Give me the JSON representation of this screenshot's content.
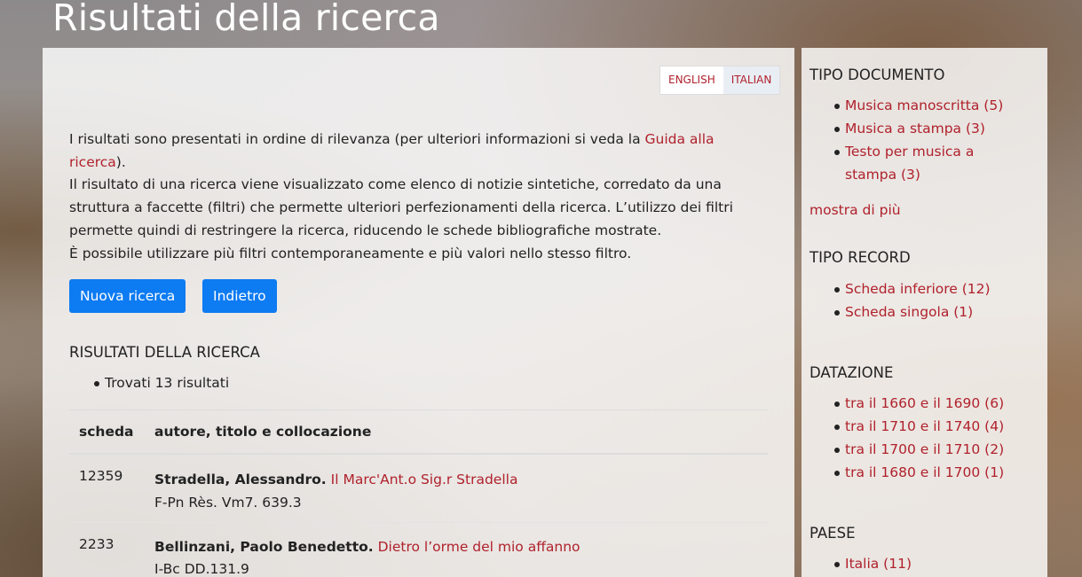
{
  "page_title": "Risultati della ricerca",
  "lang": {
    "english": "ENGLISH",
    "italian": "ITALIAN"
  },
  "intro": {
    "p1_before": "I risultati sono presentati in ordine di rilevanza (per ulteriori informazioni si veda la ",
    "p1_link": "Guida alla ricerca",
    "p1_after": ").",
    "p2": "Il risultato di una ricerca viene visualizzato come elenco di notizie sintetiche, corredato da una struttura a faccette (filtri) che permette ulteriori perfezionamenti della ricerca. L’utilizzo dei filtri permette quindi di restringere la ricerca, riducendo le schede bibliografiche mostrate.",
    "p3": "È possibile utilizzare più filtri contemporaneamente e più valori nello stesso filtro."
  },
  "buttons": {
    "new_search": "Nuova ricerca",
    "back": "Indietro"
  },
  "results": {
    "heading": "RISULTATI DELLA RICERCA",
    "count": "Trovati 13 risultati",
    "columns": [
      "scheda",
      "autore, titolo e collocazione"
    ],
    "rows": [
      {
        "id": "12359",
        "author": "Stradella, Alessandro.",
        "title": "Il Marc'Ant.o Sig.r Stradella",
        "shelfmark": "F-Pn Rès. Vm7. 639.3"
      },
      {
        "id": "2233",
        "author": "Bellinzani, Paolo Benedetto.",
        "title": "Dietro l’orme del mio affanno",
        "shelfmark": "I-Bc DD.131.9"
      }
    ]
  },
  "facets": {
    "tipo_documento": {
      "heading": "TIPO DOCUMENTO",
      "items": [
        "Musica manoscritta (5)",
        "Musica a stampa (3)",
        "Testo per musica a stampa (3)"
      ],
      "more": "mostra di più"
    },
    "tipo_record": {
      "heading": "TIPO RECORD",
      "items": [
        "Scheda inferiore (12)",
        "Scheda singola (1)"
      ]
    },
    "datazione": {
      "heading": "DATAZIONE",
      "items": [
        "tra il 1660 e il 1690 (6)",
        "tra il 1710 e il 1740 (4)",
        "tra il 1700 e il 1710 (2)",
        "tra il 1680 e il 1700 (1)"
      ]
    },
    "paese": {
      "heading": "PAESE",
      "items": [
        "Italia (11)"
      ]
    }
  }
}
